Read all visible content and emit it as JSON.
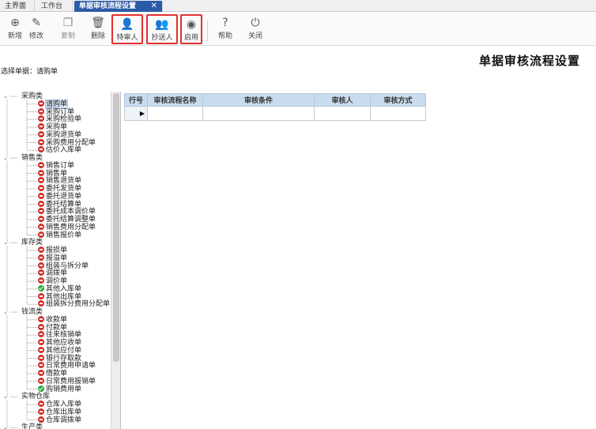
{
  "tabs": [
    {
      "label": "主界面"
    },
    {
      "label": "工作台"
    },
    {
      "label": "单据审核流程设置",
      "close": "✕"
    }
  ],
  "toolbar": {
    "buttons": [
      {
        "label": "新增",
        "icon": "add-circle-icon",
        "glyph": "⊕"
      },
      {
        "label": "修改",
        "icon": "edit-icon",
        "glyph": "✎"
      },
      {
        "label": "复制",
        "icon": "copy-icon",
        "glyph": "❐"
      },
      {
        "label": "删除",
        "icon": "trash-icon",
        "glyph": "🗑"
      },
      {
        "label": "特审人",
        "icon": "user-icon",
        "glyph": "👤"
      },
      {
        "label": "抄送人",
        "icon": "users-icon",
        "glyph": "👥"
      },
      {
        "label": "启用",
        "icon": "radio-on-icon",
        "glyph": "◉"
      },
      {
        "label": "帮助",
        "icon": "help-icon",
        "glyph": "?"
      },
      {
        "label": "关闭",
        "icon": "power-icon",
        "glyph": "⏻"
      }
    ]
  },
  "page_title": "单据审核流程设置",
  "doc_select": "选择单据：请购单",
  "tree": {
    "categories": [
      {
        "label": "采购类",
        "items": [
          "请购单",
          "采购订单",
          "采购检验单",
          "采购单",
          "采购退货单",
          "采购费用分配单",
          "估价入库单"
        ],
        "status": [
          "red",
          "red",
          "red",
          "red",
          "red",
          "red",
          "red"
        ]
      },
      {
        "label": "销售类",
        "items": [
          "销售订单",
          "销售单",
          "销售退货单",
          "委托发货单",
          "委托退货单",
          "委托结算单",
          "委托成本调价单",
          "委托结算调整单",
          "销售费用分配单",
          "销售报价单"
        ],
        "status": [
          "red",
          "red",
          "red",
          "red",
          "red",
          "red",
          "red",
          "red",
          "red",
          "red"
        ]
      },
      {
        "label": "库存类",
        "items": [
          "报损单",
          "报溢单",
          "组装与拆分单",
          "调拨单",
          "调价单",
          "其他入库单",
          "其他出库单",
          "组装拆分费用分配单"
        ],
        "status": [
          "red",
          "red",
          "red",
          "red",
          "red",
          "green",
          "red",
          "red"
        ]
      },
      {
        "label": "钱流类",
        "items": [
          "收款单",
          "付款单",
          "往来核销单",
          "其他应收单",
          "其他应付单",
          "银行存取款",
          "日常费用申请单",
          "借款单",
          "日常费用报销单",
          "购销费用单"
        ],
        "status": [
          "red",
          "red",
          "red",
          "red",
          "red",
          "red",
          "red",
          "red",
          "red",
          "green"
        ]
      },
      {
        "label": "实物仓库",
        "items": [
          "仓库入库单",
          "仓库出库单",
          "仓库调拨单"
        ],
        "status": [
          "red",
          "red",
          "red"
        ]
      },
      {
        "label": "生产类",
        "items": [],
        "status": []
      }
    ]
  },
  "grid": {
    "headers": [
      "行号",
      "审核流程名称",
      "审核条件",
      "审核人",
      "审核方式"
    ],
    "current_row_marker": "▶"
  }
}
